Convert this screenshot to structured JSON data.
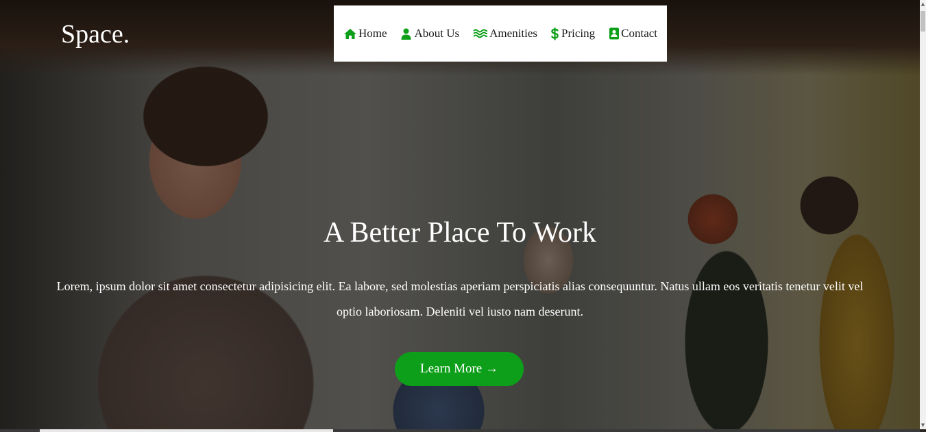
{
  "header": {
    "logo": "Space."
  },
  "nav": {
    "items": [
      {
        "label": "Home",
        "icon": "home-icon"
      },
      {
        "label": "About Us",
        "icon": "user-icon"
      },
      {
        "label": "Amenities",
        "icon": "water-icon"
      },
      {
        "label": "Pricing",
        "icon": "dollar-icon"
      },
      {
        "label": "Contact",
        "icon": "contact-card-icon"
      }
    ],
    "icon_color": "#0e9f1a"
  },
  "hero": {
    "title": "A Better Place To Work",
    "text": "Lorem, ipsum dolor sit amet consectetur adipisicing elit. Ea labore, sed molestias aperiam perspiciatis alias consequuntur. Natus ullam eos veritatis tenetur velit vel optio laboriosam. Deleniti vel iusto nam deserunt.",
    "button_label": "Learn More →",
    "button_color": "#0e9f1a"
  },
  "scrollbar": {
    "up_arrow": "▲",
    "down_arrow": "▼"
  }
}
